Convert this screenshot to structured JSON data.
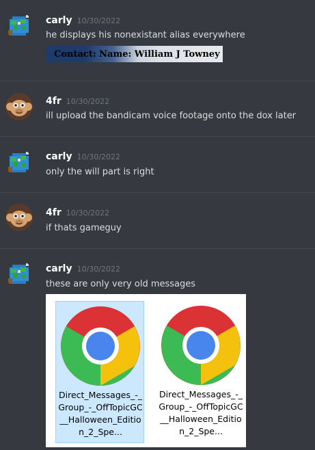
{
  "messages": [
    {
      "author": "carly",
      "timestamp": "10/30/2022",
      "text": "he displays his nonexistant alias everywhere",
      "embedded_image_text": "Contact: Name: William J Towney"
    },
    {
      "author": "4fr",
      "timestamp": "10/30/2022",
      "text": "ill upload the bandicam voice footage onto the dox later"
    },
    {
      "author": "carly",
      "timestamp": "10/30/2022",
      "text": "only the will part is right"
    },
    {
      "author": "4fr",
      "timestamp": "10/30/2022",
      "text": "if thats gameguy"
    },
    {
      "author": "carly",
      "timestamp": "10/30/2022",
      "text": "these are only very old messages",
      "attachment_files": [
        {
          "name": "Direct_Messages_-_Group_-_OffTopicGC__Halloween_Edition_2_Spe...",
          "selected": true,
          "icon": "chrome-icon"
        },
        {
          "name": "Direct_Messages_-_Group_-_OffTopicGC__Halloween_Edition_2_Spe...",
          "selected": false,
          "icon": "chrome-icon"
        }
      ]
    }
  ],
  "colors": {
    "background": "#36393f",
    "author": "#ffffff",
    "timestamp": "#72767d",
    "text": "#dcddde"
  }
}
